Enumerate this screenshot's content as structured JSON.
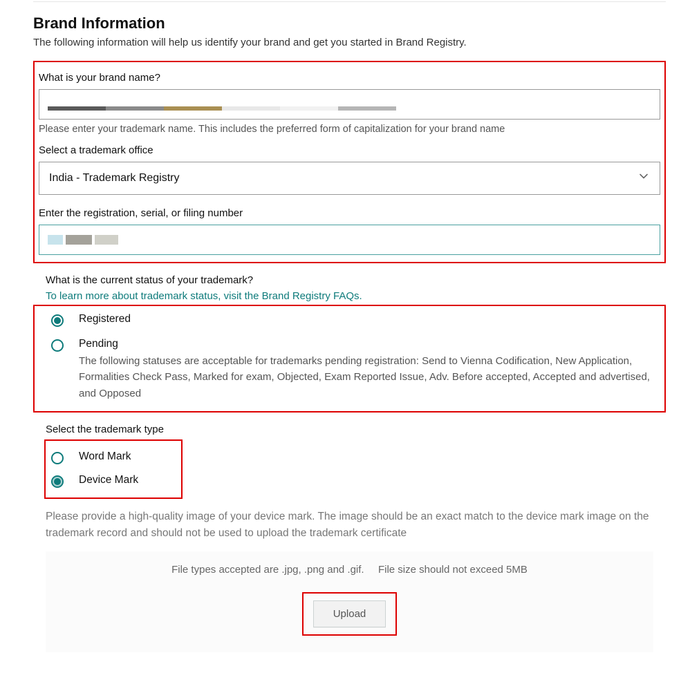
{
  "header": {
    "title": "Brand Information",
    "subtitle": "The following information will help us identify your brand and get you started in Brand Registry."
  },
  "brandName": {
    "label": "What is your brand name?",
    "value": "",
    "helper": "Please enter your trademark name. This includes the preferred form of capitalization for your brand name"
  },
  "trademarkOffice": {
    "label": "Select a trademark office",
    "selected": "India - Trademark Registry"
  },
  "registrationNumber": {
    "label": "Enter the registration, serial, or filing number",
    "value": ""
  },
  "status": {
    "label": "What is the current status of your trademark?",
    "faqLink": "To learn more about trademark status, visit the Brand Registry FAQs.",
    "options": {
      "registered": {
        "label": "Registered"
      },
      "pending": {
        "label": "Pending",
        "desc": "The following statuses are acceptable for trademarks pending registration: Send to Vienna Codification, New Application, Formalities Check Pass, Marked for exam, Objected, Exam Reported Issue, Adv. Before accepted, Accepted and advertised, and Opposed"
      }
    }
  },
  "trademarkType": {
    "label": "Select the trademark type",
    "options": {
      "word": {
        "label": "Word Mark"
      },
      "device": {
        "label": "Device Mark"
      }
    }
  },
  "deviceImage": {
    "helper": "Please provide a high-quality image of your device mark. The image should be an exact match to the device mark image on the trademark record and should not be used to upload the trademark certificate",
    "fileTypes": "File types accepted are .jpg, .png and .gif.",
    "fileSize": "File size should not exceed 5MB",
    "uploadLabel": "Upload"
  }
}
